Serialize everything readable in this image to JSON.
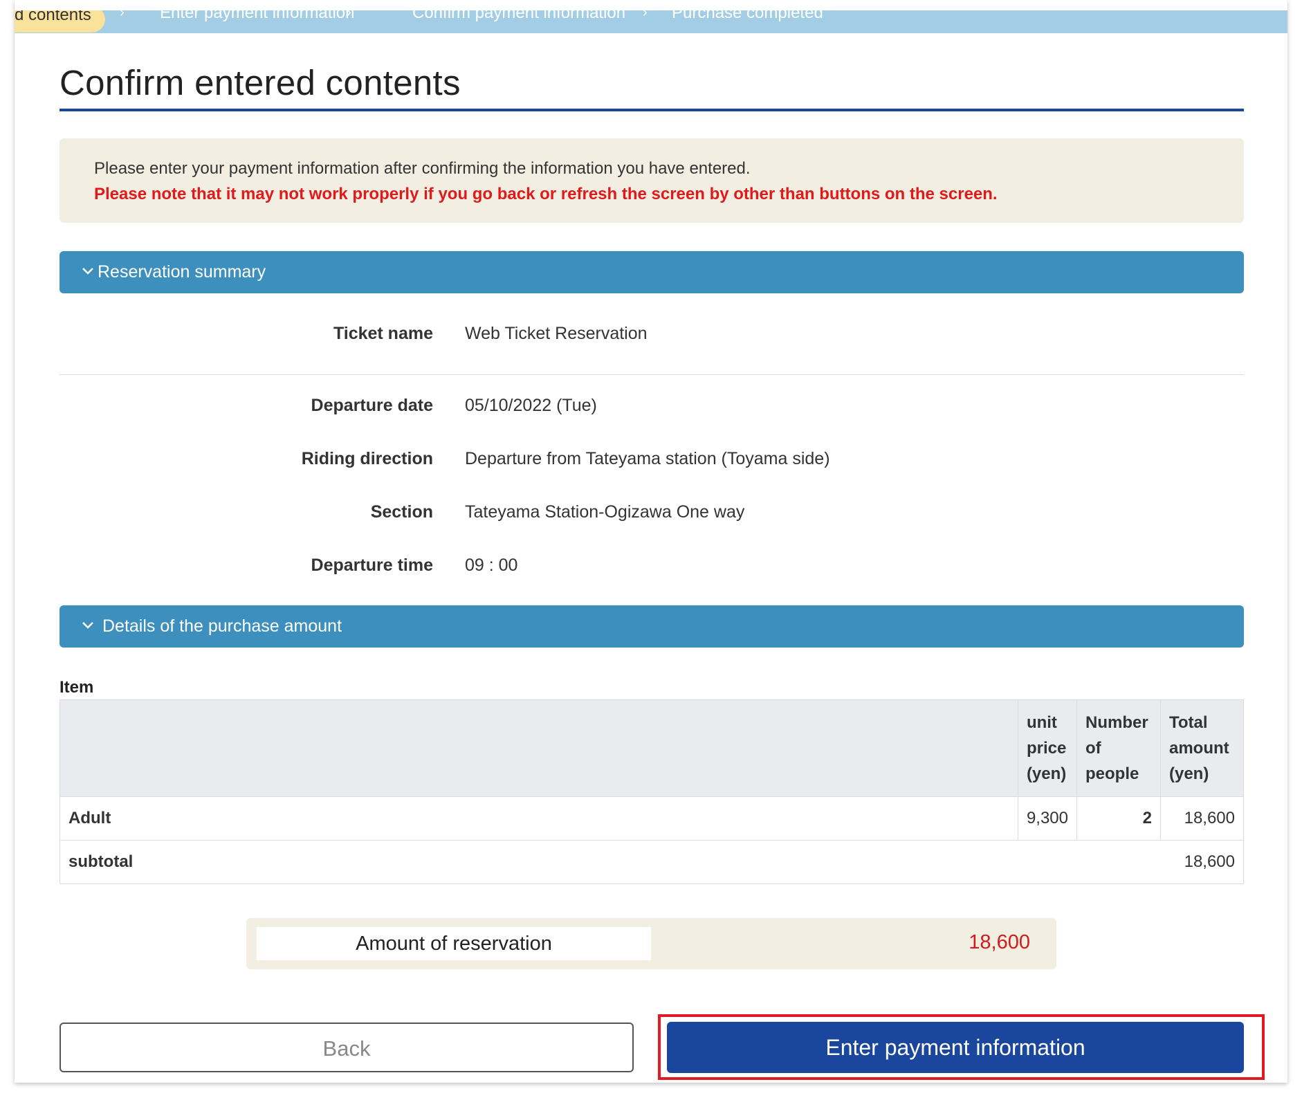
{
  "steps": [
    {
      "label": "d contents",
      "active": true
    },
    {
      "label": "Enter payment information",
      "active": false
    },
    {
      "label": "Confirm payment information",
      "active": false
    },
    {
      "label": "Purchase completed",
      "active": false
    }
  ],
  "page_title": "Confirm entered contents",
  "notice": {
    "line1": "Please enter your payment information after confirming the information you have entered.",
    "line2": "Please note that it may not work properly if you go back or refresh the screen by other than buttons on the screen."
  },
  "reservation_summary": {
    "header": "Reservation summary",
    "rows": [
      {
        "label": "Ticket name",
        "value": "Web Ticket Reservation"
      },
      {
        "label": "Departure date",
        "value": "05/10/2022 (Tue)"
      },
      {
        "label": "Riding direction",
        "value": "Departure from Tateyama station (Toyama side)"
      },
      {
        "label": "Section",
        "value": "Tateyama Station-Ogizawa One way"
      },
      {
        "label": "Departure time",
        "value": "09 : 00"
      }
    ]
  },
  "purchase_details": {
    "header": "Details of the purchase amount",
    "item_label": "Item",
    "columns": {
      "unit_price": [
        "unit",
        "price",
        "(yen)"
      ],
      "number": [
        "Number",
        "of",
        "people"
      ],
      "total": [
        "Total",
        "amount",
        "(yen)"
      ]
    },
    "rows": [
      {
        "item": "Adult",
        "unit_price": "9,300",
        "number": "2",
        "total": "18,600"
      }
    ],
    "subtotal_label": "subtotal",
    "subtotal_value": "18,600"
  },
  "reservation_amount": {
    "label": "Amount of reservation",
    "value": "18,600"
  },
  "buttons": {
    "back": "Back",
    "enter_payment": "Enter payment information"
  },
  "colors": {
    "accent": "#1a479d",
    "section_bar": "#3d8fbd",
    "alert_red": "#e01a1a",
    "notice_bg": "#f2efe2",
    "highlight": "#e01b24"
  }
}
